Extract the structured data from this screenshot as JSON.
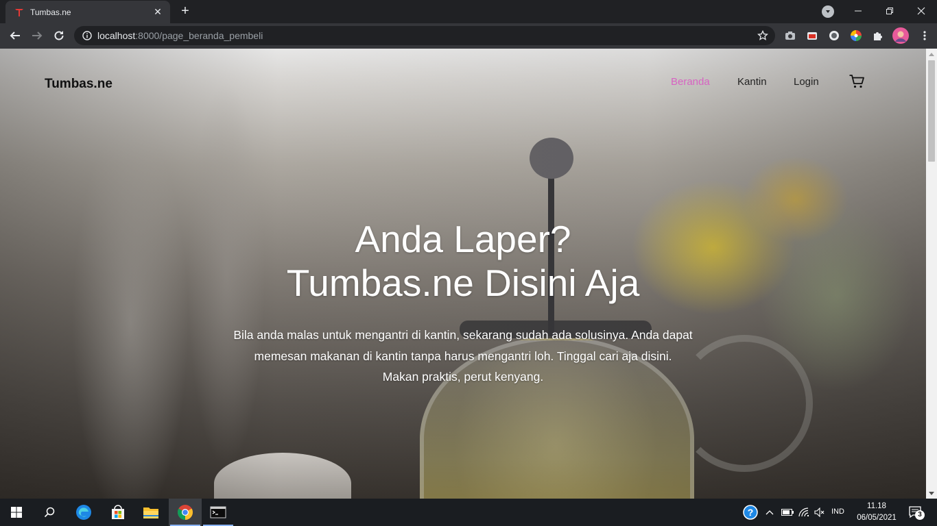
{
  "browser": {
    "tab": {
      "title": "Tumbas.ne"
    },
    "address": {
      "host": "localhost",
      "path": ":8000/page_beranda_pembeli"
    }
  },
  "page": {
    "brand": "Tumbas.ne",
    "nav": [
      {
        "label": "Beranda",
        "active": true
      },
      {
        "label": "Kantin",
        "active": false
      },
      {
        "label": "Login",
        "active": false
      }
    ],
    "hero": {
      "title_line1": "Anda Laper?",
      "title_line2": "Tumbas.ne Disini Aja",
      "desc_line1": "Bila anda malas untuk mengantri di kantin, sekarang sudah ada solusinya. Anda dapat",
      "desc_line2": "memesan makanan di kantin tanpa harus mengantri loh. Tinggal cari aja disini.",
      "desc_line3": "Makan praktis, perut kenyang."
    },
    "colors": {
      "nav_active": "#d763c2"
    }
  },
  "taskbar": {
    "lang": "IND",
    "time": "11.18",
    "date": "06/05/2021",
    "notification_count": "3",
    "icons": [
      "start-icon",
      "search-icon",
      "edge-icon",
      "store-icon",
      "file-explorer-icon",
      "chrome-icon",
      "terminal-icon"
    ]
  }
}
